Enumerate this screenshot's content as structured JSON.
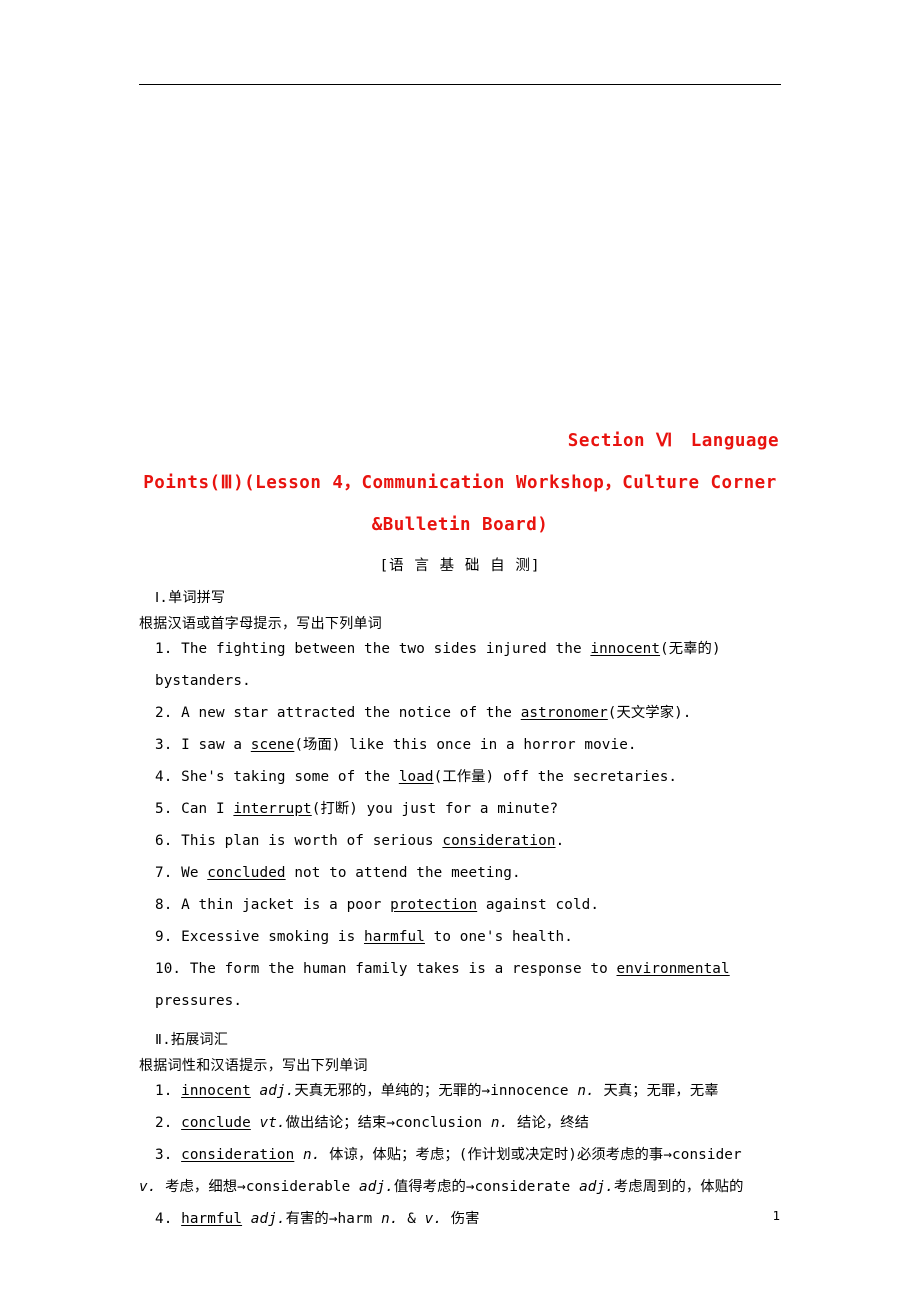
{
  "document": {
    "title_line_1": "Section Ⅵ　Language",
    "title_line_2": "Points(Ⅲ)(Lesson 4，Communication Workshop，Culture Corner",
    "title_line_3": "&Bulletin Board)",
    "subtitle": "[语 言 基 础 自 测]",
    "section_1_heading": "Ⅰ.单词拼写",
    "section_1_subheading": "根据汉语或首字母提示，写出下列单词",
    "section_1_items": [
      {
        "number": "1.",
        "parts": [
          {
            "t": "The fighting between the two sides injured the ",
            "u": false
          },
          {
            "t": "innocent",
            "u": true
          },
          {
            "t": "(无辜的) bystanders.",
            "u": false
          }
        ]
      },
      {
        "number": "2.",
        "parts": [
          {
            "t": "A new star attracted the notice of the ",
            "u": false
          },
          {
            "t": "astronomer",
            "u": true
          },
          {
            "t": "(天文学家).",
            "u": false
          }
        ]
      },
      {
        "number": "3.",
        "parts": [
          {
            "t": "I saw a ",
            "u": false
          },
          {
            "t": "scene",
            "u": true
          },
          {
            "t": "(场面) like this once in a horror movie.",
            "u": false
          }
        ]
      },
      {
        "number": "4.",
        "parts": [
          {
            "t": "She's taking some of the ",
            "u": false
          },
          {
            "t": "load",
            "u": true
          },
          {
            "t": "(工作量) off the secretaries.",
            "u": false
          }
        ]
      },
      {
        "number": "5.",
        "parts": [
          {
            "t": "Can I ",
            "u": false
          },
          {
            "t": "interrupt",
            "u": true
          },
          {
            "t": "(打断) you just for a minute?",
            "u": false
          }
        ]
      },
      {
        "number": "6.",
        "parts": [
          {
            "t": "This plan is worth of serious ",
            "u": false
          },
          {
            "t": "consideration",
            "u": true
          },
          {
            "t": ".",
            "u": false
          }
        ]
      },
      {
        "number": "7.",
        "parts": [
          {
            "t": "We ",
            "u": false
          },
          {
            "t": "concluded",
            "u": true
          },
          {
            "t": " not to attend the meeting.",
            "u": false
          }
        ]
      },
      {
        "number": "8.",
        "parts": [
          {
            "t": "A thin jacket is a poor ",
            "u": false
          },
          {
            "t": "protection",
            "u": true
          },
          {
            "t": " against cold.",
            "u": false
          }
        ]
      },
      {
        "number": "9.",
        "parts": [
          {
            "t": "Excessive smoking is ",
            "u": false
          },
          {
            "t": "harmful",
            "u": true
          },
          {
            "t": " to one's health.",
            "u": false
          }
        ]
      },
      {
        "number": "10.",
        "parts": [
          {
            "t": "The form the human family takes is a response to ",
            "u": false
          },
          {
            "t": "environmental",
            "u": true
          },
          {
            "t": " pressures.",
            "u": false
          }
        ]
      }
    ],
    "section_2_heading": "Ⅱ.拓展词汇",
    "section_2_subheading": "根据词性和汉语提示，写出下列单词",
    "section_2_items": [
      {
        "number": "1.",
        "parts": [
          {
            "t": "innocent",
            "u": true
          },
          {
            "t": " ",
            "u": false
          },
          {
            "t": "adj.",
            "u": false,
            "i": true
          },
          {
            "t": "天真无邪的，单纯的；无罪的→innocence ",
            "u": false
          },
          {
            "t": "n.",
            "u": false,
            "i": true
          },
          {
            "t": " 天真；无罪，无辜",
            "u": false
          }
        ]
      },
      {
        "number": "2.",
        "parts": [
          {
            "t": "conclude",
            "u": true
          },
          {
            "t": " ",
            "u": false
          },
          {
            "t": "vt.",
            "u": false,
            "i": true
          },
          {
            "t": "做出结论；结束→conclusion ",
            "u": false
          },
          {
            "t": "n.",
            "u": false,
            "i": true
          },
          {
            "t": " 结论，终结",
            "u": false
          }
        ]
      },
      {
        "number": "3.",
        "parts": [
          {
            "t": "consideration",
            "u": true
          },
          {
            "t": " ",
            "u": false
          },
          {
            "t": "n.",
            "u": false,
            "i": true
          },
          {
            "t": " 体谅，体贴；考虑；(作计划或决定时)必须考虑的事→consider",
            "u": false
          }
        ]
      },
      {
        "number": "",
        "continuation": true,
        "parts": [
          {
            "t": "v.",
            "u": false,
            "i": true
          },
          {
            "t": " 考虑，细想→considerable ",
            "u": false
          },
          {
            "t": "adj.",
            "u": false,
            "i": true
          },
          {
            "t": "值得考虑的→considerate ",
            "u": false
          },
          {
            "t": "adj.",
            "u": false,
            "i": true
          },
          {
            "t": "考虑周到的，体贴的",
            "u": false
          }
        ]
      },
      {
        "number": "4.",
        "parts": [
          {
            "t": "harmful",
            "u": true
          },
          {
            "t": " ",
            "u": false
          },
          {
            "t": "adj.",
            "u": false,
            "i": true
          },
          {
            "t": "有害的→harm ",
            "u": false
          },
          {
            "t": "n.",
            "u": false,
            "i": true
          },
          {
            "t": " & ",
            "u": false
          },
          {
            "t": "v.",
            "u": false,
            "i": true
          },
          {
            "t": " 伤害",
            "u": false
          }
        ]
      }
    ],
    "page_number": "1"
  }
}
